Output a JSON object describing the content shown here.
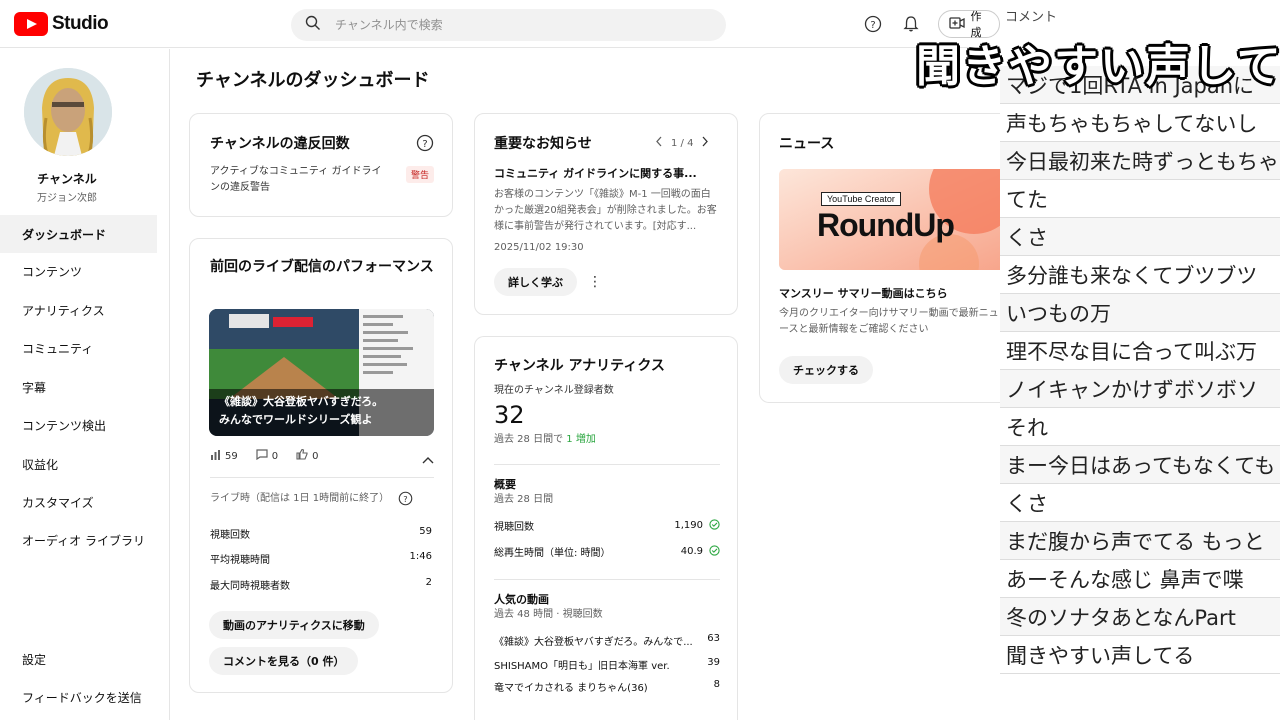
{
  "app": {
    "logo_text": "Studio",
    "brand_color": "#ff0000"
  },
  "search": {
    "placeholder": "チャンネル内で検索"
  },
  "topbar": {
    "create_label": "作成"
  },
  "channel": {
    "name": "チャンネル",
    "handle": "万ジョン次郎"
  },
  "sidebar": {
    "items": [
      {
        "label": "ダッシュボード",
        "icon": "dashboard-icon",
        "active": true
      },
      {
        "label": "コンテンツ",
        "icon": "content-icon"
      },
      {
        "label": "アナリティクス",
        "icon": "analytics-icon"
      },
      {
        "label": "コミュニティ",
        "icon": "community-icon"
      },
      {
        "label": "字幕",
        "icon": "subtitles-icon"
      },
      {
        "label": "コンテンツ検出",
        "icon": "copyright-icon"
      },
      {
        "label": "収益化",
        "icon": "monetization-icon"
      },
      {
        "label": "カスタマイズ",
        "icon": "customize-icon"
      },
      {
        "label": "オーディオ ライブラリ",
        "icon": "audio-library-icon"
      }
    ],
    "bottom": [
      {
        "label": "設定",
        "icon": "settings-icon"
      },
      {
        "label": "フィードバックを送信",
        "icon": "feedback-icon"
      }
    ]
  },
  "dashboard": {
    "title": "チャンネルのダッシュボード"
  },
  "violations": {
    "title": "チャンネルの違反回数",
    "desc": "アクティブなコミュニティ ガイドラインの違反警告",
    "badge": "警告"
  },
  "live": {
    "title": "前回のライブ配信のパフォーマンス",
    "thumb_caption_1": "《雑談》大谷登板ヤバすぎだろ。",
    "thumb_caption_2": "みんなでワールドシリーズ観よ",
    "views": "59",
    "comments": "0",
    "likes": "0",
    "live_time": "ライブ時（配信は 1日 1時間前に終了）",
    "stats": [
      {
        "label": "視聴回数",
        "value": "59"
      },
      {
        "label": "平均視聴時間",
        "value": "1:46"
      },
      {
        "label": "最大同時視聴者数",
        "value": "2"
      }
    ],
    "btn_analytics": "動画のアナリティクスに移動",
    "btn_comments": "コメントを見る（0 件）"
  },
  "notice": {
    "title": "重要なお知らせ",
    "pager": "1 / 4",
    "headline": "コミュニティ ガイドラインに関する事...",
    "body": "お客様のコンテンツ「《雑談》M-1 一回戦の面白かった厳選20組発表会」が削除されました。お客様に事前警告が発行されています。[対応す...",
    "date": "2025/11/02 19:30",
    "btn": "詳しく学ぶ"
  },
  "analytics": {
    "title": "チャンネル アナリティクス",
    "subs_label": "現在のチャンネル登録者数",
    "subs_value": "32",
    "subs_delta_prefix": "過去 28 日間で",
    "subs_delta": "1 増加",
    "summary_title": "概要",
    "summary_sub": "過去 28 日間",
    "summary": [
      {
        "label": "視聴回数",
        "value": "1,190"
      },
      {
        "label": "総再生時間（単位: 時間）",
        "value": "40.9"
      }
    ],
    "top_title": "人気の動画",
    "top_sub": "過去 48 時間 · 視聴回数",
    "top": [
      {
        "label": "《雑談》大谷登板ヤバすぎだろ。みんなで...",
        "value": "63"
      },
      {
        "label": "SHISHAMO「明日も」旧日本海軍 ver.",
        "value": "39"
      },
      {
        "label": "竜マでイカされる まりちゃん(36)",
        "value": "8"
      }
    ]
  },
  "news": {
    "title": "ニュース",
    "banner_tag": "YouTube Creator",
    "banner_text": "RoundUp",
    "headline": "マンスリー サマリー動画はこちら",
    "body": "今月のクリエイター向けサマリー動画で最新ニュースと最新情報をご確認ください",
    "btn": "チェックする"
  },
  "comments": {
    "header": "コメント",
    "overlay": "聞きやすい声してる",
    "items": [
      "マジで1回RTA in Japanに",
      "声もちゃもちゃしてないし",
      "今日最初来た時ずっともちゃ",
      "てた",
      "くさ",
      "多分誰も来なくてブツブツ",
      "いつもの万",
      "理不尽な目に合って叫ぶ万",
      "ノイキャンかけずボソボソ",
      "それ",
      "まー今日はあってもなくても",
      "くさ",
      "まだ腹から声でてる もっと",
      "あーそんな感じ 鼻声で喋",
      "冬のソナタあとなんPart",
      "聞きやすい声してる"
    ]
  }
}
